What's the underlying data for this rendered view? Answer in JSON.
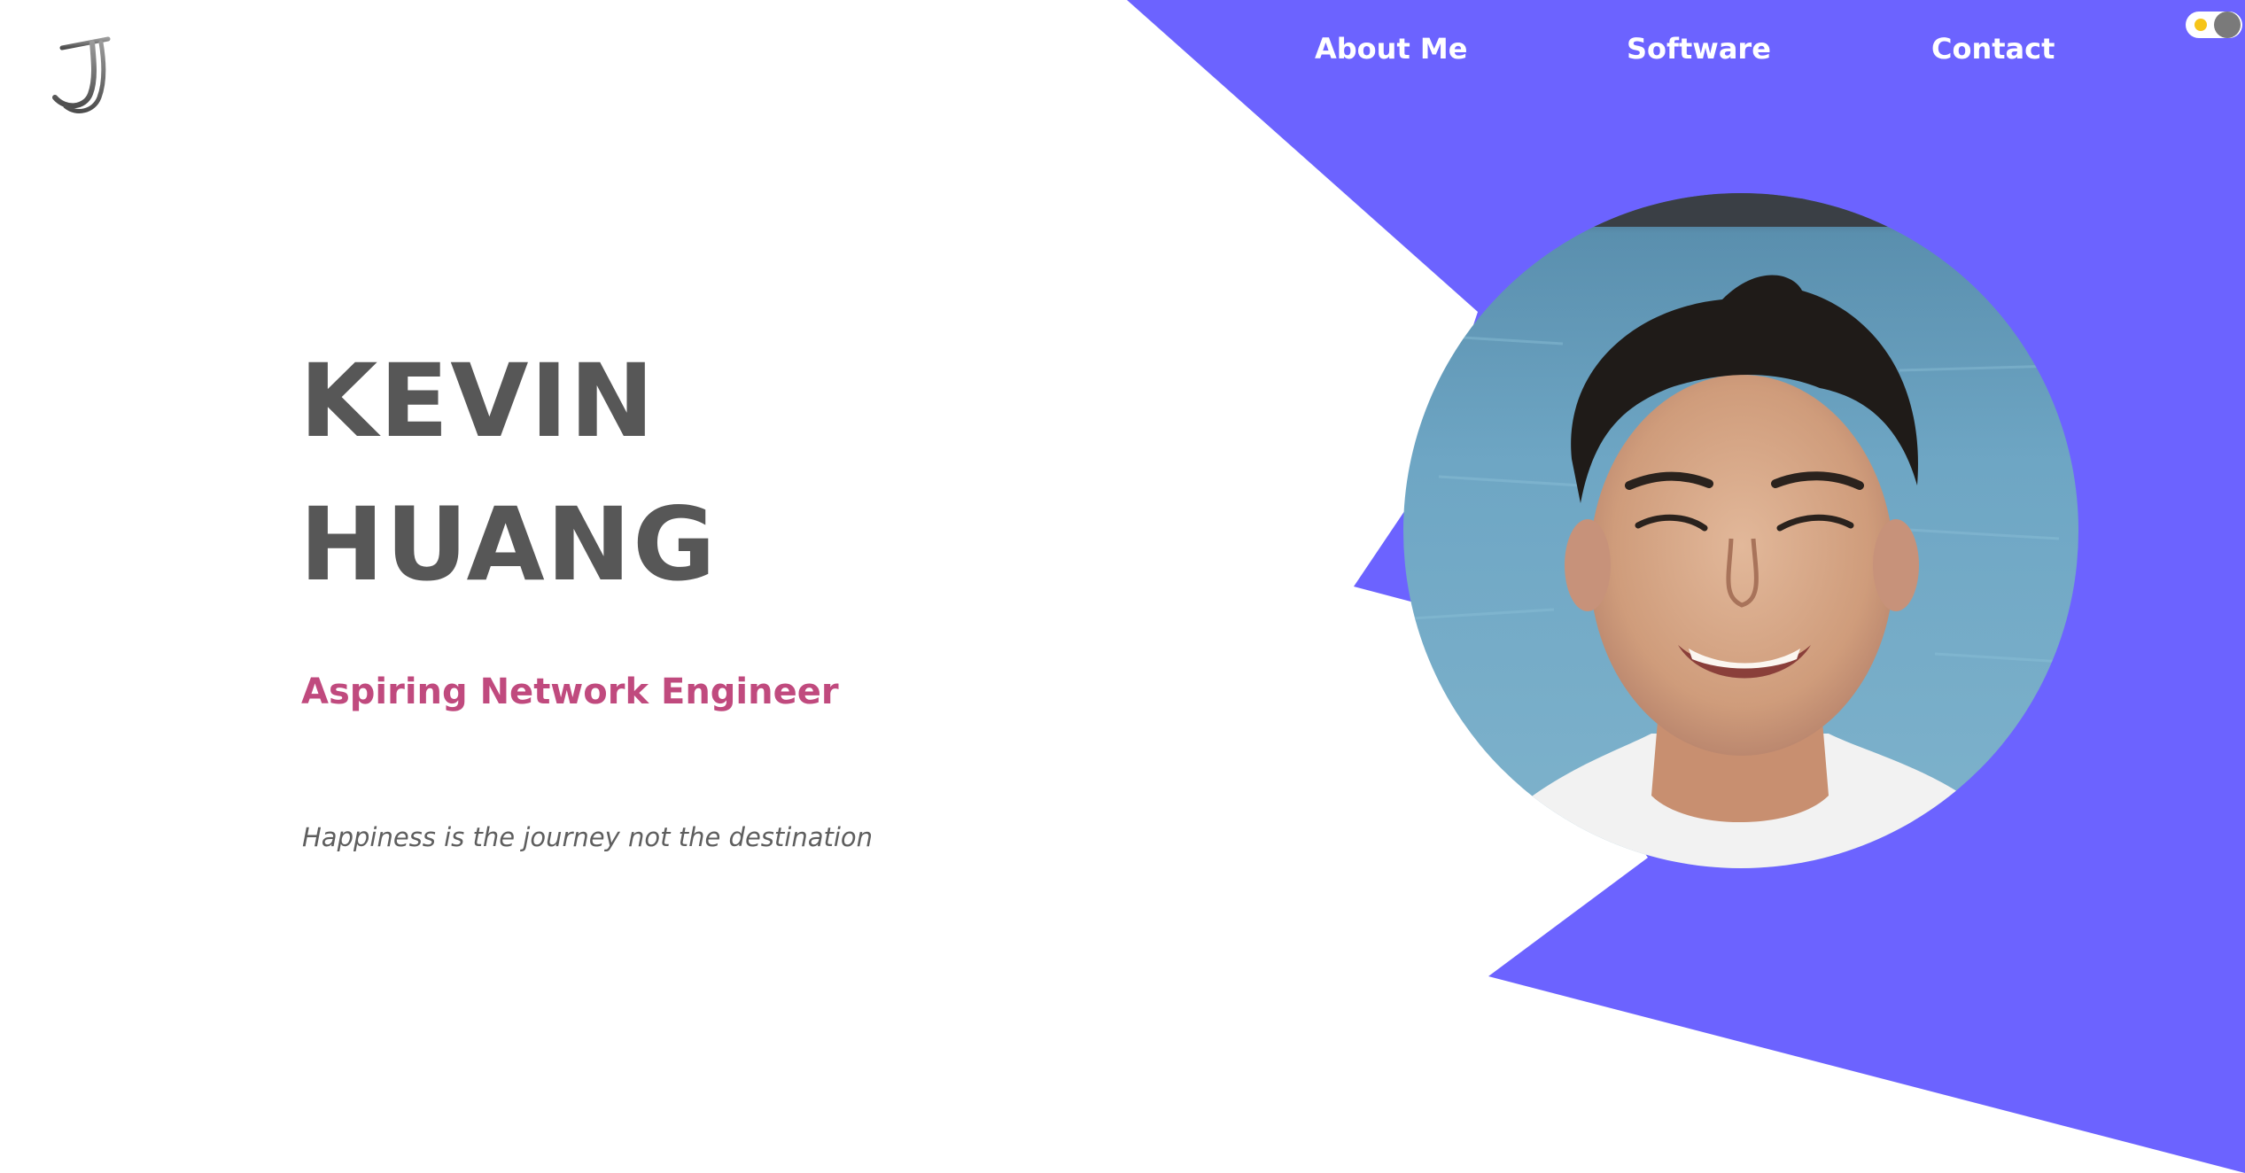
{
  "header": {
    "nav": [
      {
        "label": "About Me"
      },
      {
        "label": "Software"
      },
      {
        "label": "Contact"
      }
    ],
    "theme_toggle": {
      "state": "light"
    }
  },
  "hero": {
    "name_first": "KEVIN",
    "name_last": "HUANG",
    "role": "Aspiring Network Engineer",
    "quote": "Happiness is the journey not the destination"
  },
  "colors": {
    "accent": "#6c63ff",
    "name_text": "#575757",
    "role_text": "#c04a7e",
    "quote_text": "#5e5e5e",
    "toggle_sun": "#f6c518"
  },
  "icons": {
    "logo": "j-monogram-logo",
    "toggle": "sun-icon"
  }
}
